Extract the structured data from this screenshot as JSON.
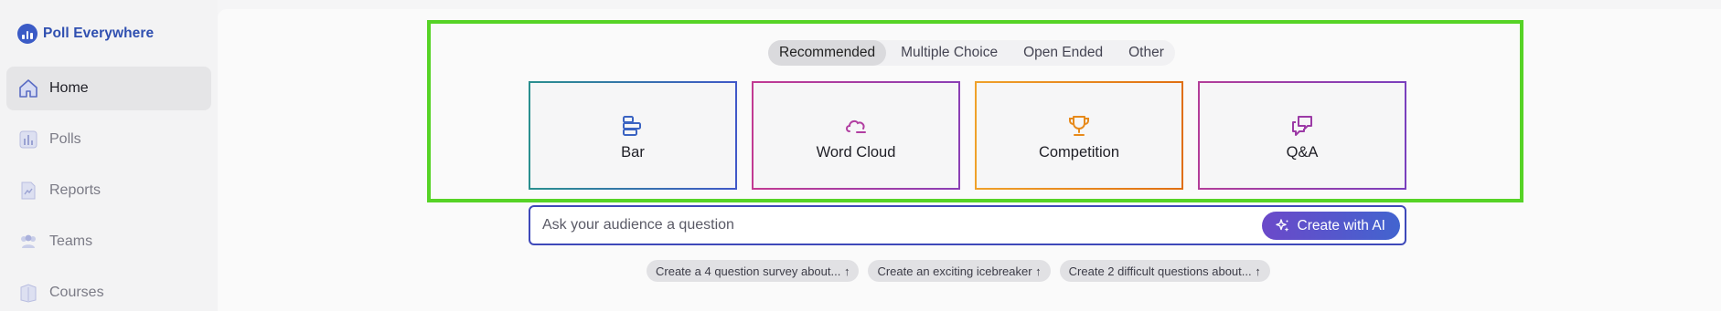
{
  "brand": {
    "name": "Poll Everywhere"
  },
  "sidebar": {
    "items": [
      {
        "label": "Home",
        "icon": "home-icon",
        "active": true
      },
      {
        "label": "Polls",
        "icon": "polls-icon"
      },
      {
        "label": "Reports",
        "icon": "reports-icon"
      },
      {
        "label": "Teams",
        "icon": "teams-icon"
      },
      {
        "label": "Courses",
        "icon": "courses-icon"
      }
    ]
  },
  "tabs": [
    {
      "label": "Recommended",
      "active": true
    },
    {
      "label": "Multiple Choice"
    },
    {
      "label": "Open Ended"
    },
    {
      "label": "Other"
    }
  ],
  "cards": [
    {
      "label": "Bar",
      "icon": "bar-chart-icon",
      "color": "#3a63c2"
    },
    {
      "label": "Word Cloud",
      "icon": "cloud-icon",
      "color": "#b13ea1"
    },
    {
      "label": "Competition",
      "icon": "trophy-icon",
      "color": "#e78a1b"
    },
    {
      "label": "Q&A",
      "icon": "chat-bubbles-icon",
      "color": "#9c3aa6"
    }
  ],
  "ask": {
    "placeholder": "Ask your audience a question",
    "button_label": "Create with AI"
  },
  "suggestions": [
    "Create a 4 question survey about... ↑",
    "Create an exciting icebreaker ↑",
    "Create 2 difficult questions about... ↑"
  ],
  "colors": {
    "highlight": "#56d326",
    "brand": "#2f4fb0",
    "ask_border": "#3e49b9"
  }
}
